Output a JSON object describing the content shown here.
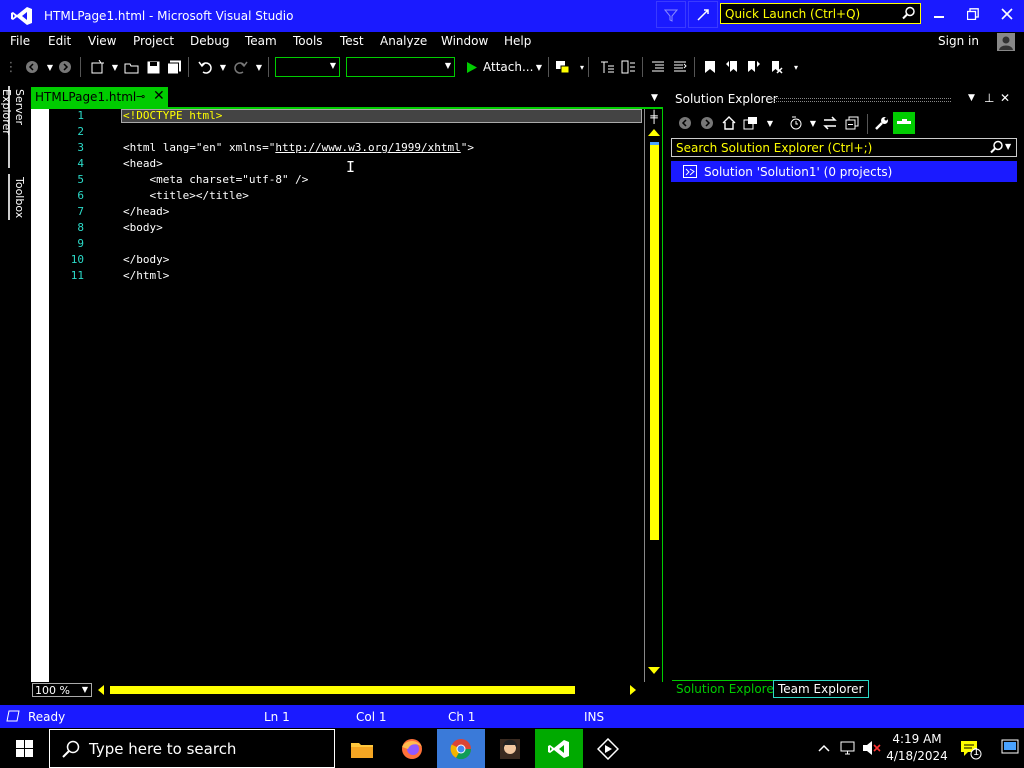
{
  "window": {
    "title": "HTMLPage1.html - Microsoft Visual Studio",
    "quick_launch_placeholder": "Quick Launch (Ctrl+Q)"
  },
  "menu": [
    "File",
    "Edit",
    "View",
    "Project",
    "Debug",
    "Team",
    "Tools",
    "Test",
    "Analyze",
    "Window",
    "Help"
  ],
  "signin": "Sign in",
  "toolbar": {
    "attach_label": "Attach...",
    "combo1_value": "",
    "combo2_value": ""
  },
  "left_strip": [
    "Server Explorer",
    "Toolbox"
  ],
  "document_tab": {
    "label": "HTMLPage1.html"
  },
  "editor": {
    "line_numbers": [
      "1",
      "2",
      "3",
      "4",
      "5",
      "6",
      "7",
      "8",
      "9",
      "10",
      "11"
    ],
    "lines": [
      "<!DOCTYPE html>",
      "",
      "<html lang=\"en\" xmlns=\"",
      "<head>",
      "    <meta charset=\"utf-8\" />",
      "    <title></title>",
      "</head>",
      "<body>",
      "",
      "</body>",
      "</html>"
    ],
    "line3_link": "http://www.w3.org/1999/xhtml",
    "line3_tail": "\">",
    "zoom": "100 %"
  },
  "solution_explorer": {
    "title": "Solution Explorer",
    "search_placeholder": "Search Solution Explorer (Ctrl+;)",
    "selected_item": "Solution 'Solution1' (0 projects)",
    "tabs": [
      "Solution Explorer",
      "Team Explorer"
    ]
  },
  "status": {
    "state": "Ready",
    "ln": "Ln 1",
    "col": "Col 1",
    "ch": "Ch 1",
    "mode": "INS"
  },
  "taskbar": {
    "search_placeholder": "Type here to search",
    "time": "4:19 AM",
    "date": "4/18/2024",
    "notification_count": "1"
  },
  "colors": {
    "title_blue": "#1a1aff",
    "accent_green": "#00cc00",
    "accent_yellow": "#ffff00",
    "line_number_cyan": "#2bdac8"
  }
}
